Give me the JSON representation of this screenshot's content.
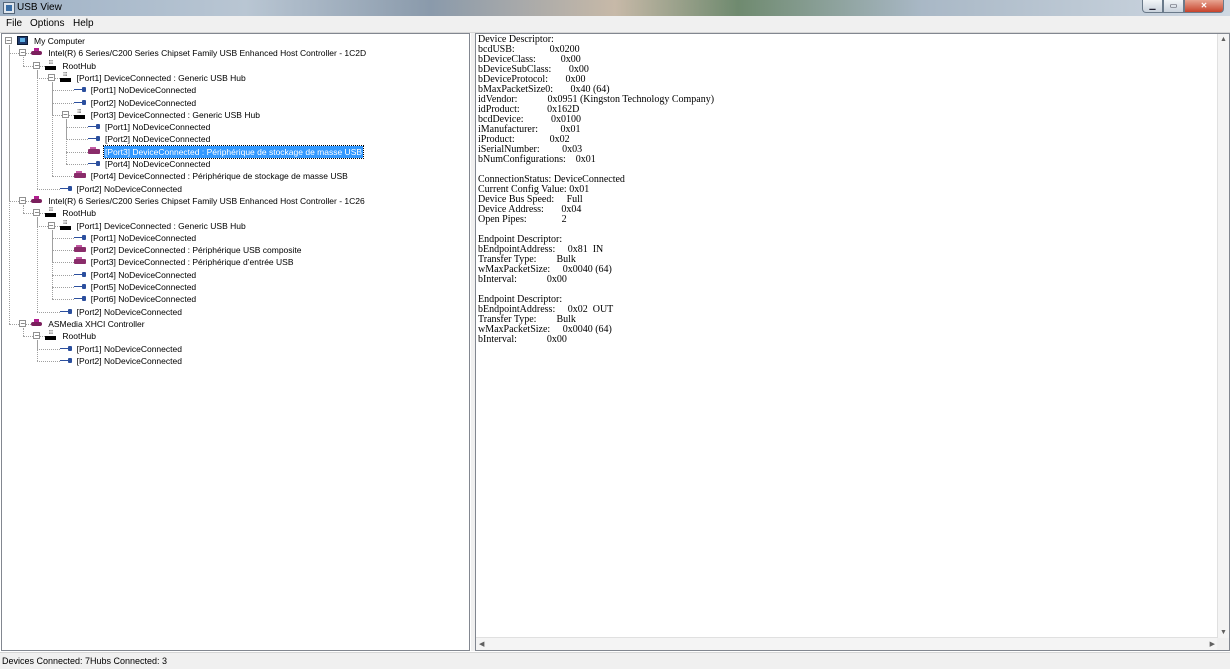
{
  "window": {
    "title": "USB View"
  },
  "menu": [
    "File",
    "Options",
    "Help"
  ],
  "tree": [
    {
      "label": "My Computer",
      "icon": "computer-icon",
      "level": 0,
      "expander": "−"
    },
    {
      "label": "Intel(R) 6 Series/C200 Series Chipset Family USB Enhanced Host Controller - 1C2D",
      "icon": "usb-controller-icon",
      "level": 1,
      "expander": "−"
    },
    {
      "label": "RootHub",
      "icon": "hub-icon",
      "level": 2,
      "expander": "−"
    },
    {
      "label": "[Port1] DeviceConnected :  Generic USB Hub",
      "icon": "hub-icon",
      "level": 3,
      "expander": "−"
    },
    {
      "label": "[Port1] NoDeviceConnected",
      "icon": "usb-plug-icon",
      "level": 4
    },
    {
      "label": "[Port2] NoDeviceConnected",
      "icon": "usb-plug-icon",
      "level": 4
    },
    {
      "label": "[Port3] DeviceConnected :  Generic USB Hub",
      "icon": "hub-icon",
      "level": 4,
      "expander": "−"
    },
    {
      "label": "[Port1] NoDeviceConnected",
      "icon": "usb-plug-icon",
      "level": 5
    },
    {
      "label": "[Port2] NoDeviceConnected",
      "icon": "usb-plug-icon",
      "level": 5
    },
    {
      "label": "[Port3] DeviceConnected :  Périphérique de stockage de masse USB",
      "icon": "usb-device-icon",
      "level": 5,
      "selected": true
    },
    {
      "label": "[Port4] NoDeviceConnected",
      "icon": "usb-plug-icon",
      "level": 5
    },
    {
      "label": "[Port4] DeviceConnected :  Périphérique de stockage de masse USB",
      "icon": "usb-device-icon",
      "level": 4
    },
    {
      "label": "[Port2] NoDeviceConnected",
      "icon": "usb-plug-icon",
      "level": 3
    },
    {
      "label": "Intel(R) 6 Series/C200 Series Chipset Family USB Enhanced Host Controller - 1C26",
      "icon": "usb-controller-icon",
      "level": 1,
      "expander": "−"
    },
    {
      "label": "RootHub",
      "icon": "hub-icon",
      "level": 2,
      "expander": "−"
    },
    {
      "label": "[Port1] DeviceConnected :  Generic USB Hub",
      "icon": "hub-icon",
      "level": 3,
      "expander": "−"
    },
    {
      "label": "[Port1] NoDeviceConnected",
      "icon": "usb-plug-icon",
      "level": 4
    },
    {
      "label": "[Port2] DeviceConnected :  Périphérique USB composite",
      "icon": "usb-device-icon",
      "level": 4
    },
    {
      "label": "[Port3] DeviceConnected :  Périphérique d’entrée USB",
      "icon": "usb-device-icon",
      "level": 4
    },
    {
      "label": "[Port4] NoDeviceConnected",
      "icon": "usb-plug-icon",
      "level": 4
    },
    {
      "label": "[Port5] NoDeviceConnected",
      "icon": "usb-plug-icon",
      "level": 4
    },
    {
      "label": "[Port6] NoDeviceConnected",
      "icon": "usb-plug-icon",
      "level": 4
    },
    {
      "label": "[Port2] NoDeviceConnected",
      "icon": "usb-plug-icon",
      "level": 3
    },
    {
      "label": "ASMedia XHCI Controller",
      "icon": "usb-controller-icon",
      "level": 1,
      "expander": "−"
    },
    {
      "label": "RootHub",
      "icon": "hub-icon",
      "level": 2,
      "expander": "−"
    },
    {
      "label": "[Port1] NoDeviceConnected",
      "icon": "usb-plug-icon",
      "level": 3
    },
    {
      "label": "[Port2] NoDeviceConnected",
      "icon": "usb-plug-icon",
      "level": 3
    }
  ],
  "details": [
    "Device Descriptor:",
    "bcdUSB:              0x0200",
    "bDeviceClass:          0x00",
    "bDeviceSubClass:       0x00",
    "bDeviceProtocol:       0x00",
    "bMaxPacketSize0:       0x40 (64)",
    "idVendor:            0x0951 (Kingston Technology Company)",
    "idProduct:           0x162D",
    "bcdDevice:           0x0100",
    "iManufacturer:         0x01",
    "iProduct:              0x02",
    "iSerialNumber:         0x03",
    "bNumConfigurations:    0x01",
    "",
    "ConnectionStatus: DeviceConnected",
    "Current Config Value: 0x01",
    "Device Bus Speed:     Full",
    "Device Address:       0x04",
    "Open Pipes:              2",
    "",
    "Endpoint Descriptor:",
    "bEndpointAddress:     0x81  IN",
    "Transfer Type:        Bulk",
    "wMaxPacketSize:     0x0040 (64)",
    "bInterval:            0x00",
    "",
    "Endpoint Descriptor:",
    "bEndpointAddress:     0x02  OUT",
    "Transfer Type:        Bulk",
    "wMaxPacketSize:     0x0040 (64)",
    "bInterval:            0x00"
  ],
  "status": {
    "devices_connected": "Devices Connected: 7",
    "hubs_connected": "Hubs Connected: 3"
  },
  "colors": {
    "selection": "#3399ff",
    "chrome": "#f0f0f0",
    "border": "#828790"
  }
}
